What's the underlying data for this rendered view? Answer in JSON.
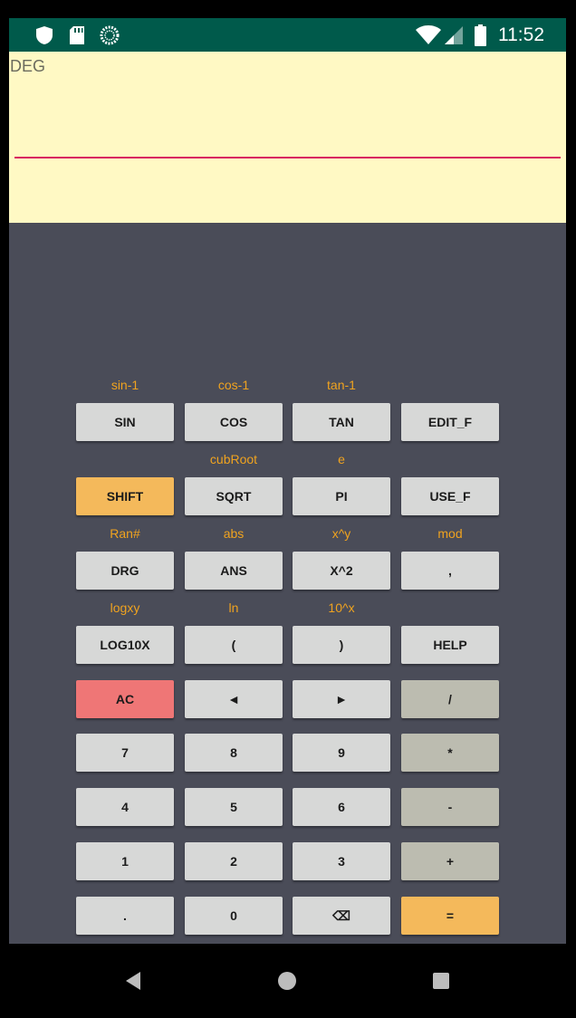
{
  "status_bar": {
    "time": "11:52",
    "icons": [
      "shield-icon",
      "sd-card-icon",
      "sync-icon",
      "wifi-icon",
      "cell-signal-icon",
      "battery-icon"
    ]
  },
  "display": {
    "mode": "DEG",
    "expression": "",
    "underline_color": "#d81b60"
  },
  "keypad": {
    "shift_labels": [
      [
        "sin-1",
        "cos-1",
        "tan-1",
        ""
      ],
      [
        "",
        "cubRoot",
        "e",
        ""
      ],
      [
        "Ran#",
        "abs",
        "x^y",
        "mod"
      ],
      [
        "logxy",
        "ln",
        "10^x",
        ""
      ]
    ],
    "rows": [
      [
        "SIN",
        "COS",
        "TAN",
        "EDIT_F"
      ],
      [
        "SHIFT",
        "SQRT",
        "PI",
        "USE_F"
      ],
      [
        "DRG",
        "ANS",
        "X^2",
        ","
      ],
      [
        "LOG10X",
        "(",
        ")",
        "HELP"
      ],
      [
        "AC",
        "◄",
        "►",
        "/"
      ],
      [
        "7",
        "8",
        "9",
        "*"
      ],
      [
        "4",
        "5",
        "6",
        "-"
      ],
      [
        "1",
        "2",
        "3",
        "+"
      ],
      [
        ".",
        "0",
        "⌫",
        "="
      ]
    ]
  },
  "colors": {
    "status_bar": "#005a4b",
    "display_bg": "#fff9c4",
    "keypad_bg": "#4a4c58",
    "shift_label": "#f0a31f",
    "key_default": "#d7d8d7",
    "key_shift": "#f4b95b",
    "key_ac": "#ef7676",
    "key_operator": "#bcbcb0",
    "key_equals": "#f4b95b"
  },
  "nav_bar": {
    "icons": [
      "back-icon",
      "home-icon",
      "recents-icon"
    ]
  }
}
